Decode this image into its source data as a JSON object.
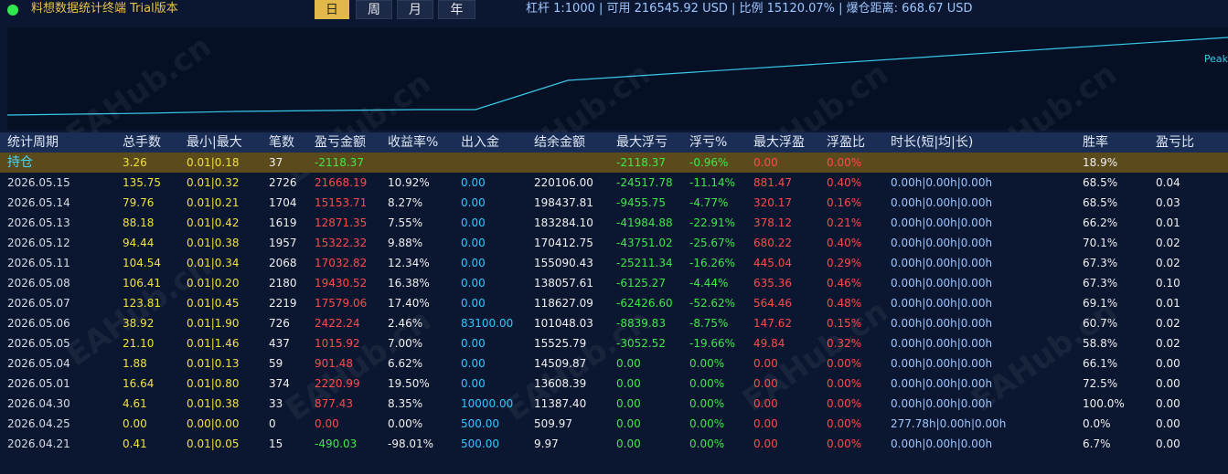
{
  "app": {
    "title": "料想数据统计终端 Trial版本",
    "account_info": "杠杆 1:1000 | 可用 216545.92 USD | 比例 15120.07% | 爆仓距离: 668.67 USD"
  },
  "period_buttons": [
    {
      "label": "日",
      "active": true
    },
    {
      "label": "周",
      "active": false
    },
    {
      "label": "月",
      "active": false
    },
    {
      "label": "年",
      "active": false
    }
  ],
  "chart": {
    "peak_label": "Peak",
    "line_color": "#37c9e8"
  },
  "watermark": "EAHub.cn",
  "table": {
    "headers": [
      "统计周期",
      "总手数",
      "最小|最大",
      "笔数",
      "盈亏金额",
      "收益率%",
      "出入金",
      "结余金额",
      "最大浮亏",
      "浮亏%",
      "最大浮盈",
      "浮盈比",
      "时长(短|均|长)",
      "胜率",
      "盈亏比"
    ],
    "hold_row": {
      "label": "持仓",
      "lots": "3.26",
      "minmax": "0.01|0.18",
      "count": "37",
      "pnl": "-2118.37",
      "max_float_loss": "-2118.37",
      "float_loss_pct": "-0.96%",
      "max_float_profit": "0.00",
      "float_profit_ratio": "0.00%",
      "win_rate": "18.9%"
    },
    "rows": [
      {
        "date": "2026.05.15",
        "lots": "135.75",
        "minmax": "0.01|0.32",
        "count": "2726",
        "pnl": "21668.19",
        "ret": "10.92%",
        "flow": "0.00",
        "balance": "220106.00",
        "mfl": "-24517.78",
        "flp": "-11.14%",
        "mfp": "881.47",
        "fpr": "0.40%",
        "dur": "0.00h|0.00h|0.00h",
        "win": "68.5%",
        "pl": "0.04"
      },
      {
        "date": "2026.05.14",
        "lots": "79.76",
        "minmax": "0.01|0.21",
        "count": "1704",
        "pnl": "15153.71",
        "ret": "8.27%",
        "flow": "0.00",
        "balance": "198437.81",
        "mfl": "-9455.75",
        "flp": "-4.77%",
        "mfp": "320.17",
        "fpr": "0.16%",
        "dur": "0.00h|0.00h|0.00h",
        "win": "68.5%",
        "pl": "0.03"
      },
      {
        "date": "2026.05.13",
        "lots": "88.18",
        "minmax": "0.01|0.42",
        "count": "1619",
        "pnl": "12871.35",
        "ret": "7.55%",
        "flow": "0.00",
        "balance": "183284.10",
        "mfl": "-41984.88",
        "flp": "-22.91%",
        "mfp": "378.12",
        "fpr": "0.21%",
        "dur": "0.00h|0.00h|0.00h",
        "win": "66.2%",
        "pl": "0.01"
      },
      {
        "date": "2026.05.12",
        "lots": "94.44",
        "minmax": "0.01|0.38",
        "count": "1957",
        "pnl": "15322.32",
        "ret": "9.88%",
        "flow": "0.00",
        "balance": "170412.75",
        "mfl": "-43751.02",
        "flp": "-25.67%",
        "mfp": "680.22",
        "fpr": "0.40%",
        "dur": "0.00h|0.00h|0.00h",
        "win": "70.1%",
        "pl": "0.02"
      },
      {
        "date": "2026.05.11",
        "lots": "104.54",
        "minmax": "0.01|0.34",
        "count": "2068",
        "pnl": "17032.82",
        "ret": "12.34%",
        "flow": "0.00",
        "balance": "155090.43",
        "mfl": "-25211.34",
        "flp": "-16.26%",
        "mfp": "445.04",
        "fpr": "0.29%",
        "dur": "0.00h|0.00h|0.00h",
        "win": "67.3%",
        "pl": "0.02"
      },
      {
        "date": "2026.05.08",
        "lots": "106.41",
        "minmax": "0.01|0.20",
        "count": "2180",
        "pnl": "19430.52",
        "ret": "16.38%",
        "flow": "0.00",
        "balance": "138057.61",
        "mfl": "-6125.27",
        "flp": "-4.44%",
        "mfp": "635.36",
        "fpr": "0.46%",
        "dur": "0.00h|0.00h|0.00h",
        "win": "67.3%",
        "pl": "0.10"
      },
      {
        "date": "2026.05.07",
        "lots": "123.81",
        "minmax": "0.01|0.45",
        "count": "2219",
        "pnl": "17579.06",
        "ret": "17.40%",
        "flow": "0.00",
        "balance": "118627.09",
        "mfl": "-62426.60",
        "flp": "-52.62%",
        "mfp": "564.46",
        "fpr": "0.48%",
        "dur": "0.00h|0.00h|0.00h",
        "win": "69.1%",
        "pl": "0.01"
      },
      {
        "date": "2026.05.06",
        "lots": "38.92",
        "minmax": "0.01|1.90",
        "count": "726",
        "pnl": "2422.24",
        "ret": "2.46%",
        "flow": "83100.00",
        "balance": "101048.03",
        "mfl": "-8839.83",
        "flp": "-8.75%",
        "mfp": "147.62",
        "fpr": "0.15%",
        "dur": "0.00h|0.00h|0.00h",
        "win": "60.7%",
        "pl": "0.02"
      },
      {
        "date": "2026.05.05",
        "lots": "21.10",
        "minmax": "0.01|1.46",
        "count": "437",
        "pnl": "1015.92",
        "ret": "7.00%",
        "flow": "0.00",
        "balance": "15525.79",
        "mfl": "-3052.52",
        "flp": "-19.66%",
        "mfp": "49.84",
        "fpr": "0.32%",
        "dur": "0.00h|0.00h|0.00h",
        "win": "58.8%",
        "pl": "0.02"
      },
      {
        "date": "2026.05.04",
        "lots": "1.88",
        "minmax": "0.01|0.13",
        "count": "59",
        "pnl": "901.48",
        "ret": "6.62%",
        "flow": "0.00",
        "balance": "14509.87",
        "mfl": "0.00",
        "flp": "0.00%",
        "mfp": "0.00",
        "fpr": "0.00%",
        "dur": "0.00h|0.00h|0.00h",
        "win": "66.1%",
        "pl": "0.00"
      },
      {
        "date": "2026.05.01",
        "lots": "16.64",
        "minmax": "0.01|0.80",
        "count": "374",
        "pnl": "2220.99",
        "ret": "19.50%",
        "flow": "0.00",
        "balance": "13608.39",
        "mfl": "0.00",
        "flp": "0.00%",
        "mfp": "0.00",
        "fpr": "0.00%",
        "dur": "0.00h|0.00h|0.00h",
        "win": "72.5%",
        "pl": "0.00"
      },
      {
        "date": "2026.04.30",
        "lots": "4.61",
        "minmax": "0.01|0.38",
        "count": "33",
        "pnl": "877.43",
        "ret": "8.35%",
        "flow": "10000.00",
        "balance": "11387.40",
        "mfl": "0.00",
        "flp": "0.00%",
        "mfp": "0.00",
        "fpr": "0.00%",
        "dur": "0.00h|0.00h|0.00h",
        "win": "100.0%",
        "pl": "0.00"
      },
      {
        "date": "2026.04.25",
        "lots": "0.00",
        "minmax": "0.00|0.00",
        "count": "0",
        "pnl": "0.00",
        "ret": "0.00%",
        "flow": "500.00",
        "balance": "509.97",
        "mfl": "0.00",
        "flp": "0.00%",
        "mfp": "0.00",
        "fpr": "0.00%",
        "dur": "277.78h|0.00h|0.00h",
        "win": "0.0%",
        "pl": "0.00"
      },
      {
        "date": "2026.04.21",
        "lots": "0.41",
        "minmax": "0.01|0.05",
        "count": "15",
        "pnl": "-490.03",
        "ret": "-98.01%",
        "flow": "500.00",
        "balance": "9.97",
        "mfl": "0.00",
        "flp": "0.00%",
        "mfp": "0.00",
        "fpr": "0.00%",
        "dur": "0.00h|0.00h|0.00h",
        "win": "6.7%",
        "pl": "0.00"
      }
    ]
  }
}
